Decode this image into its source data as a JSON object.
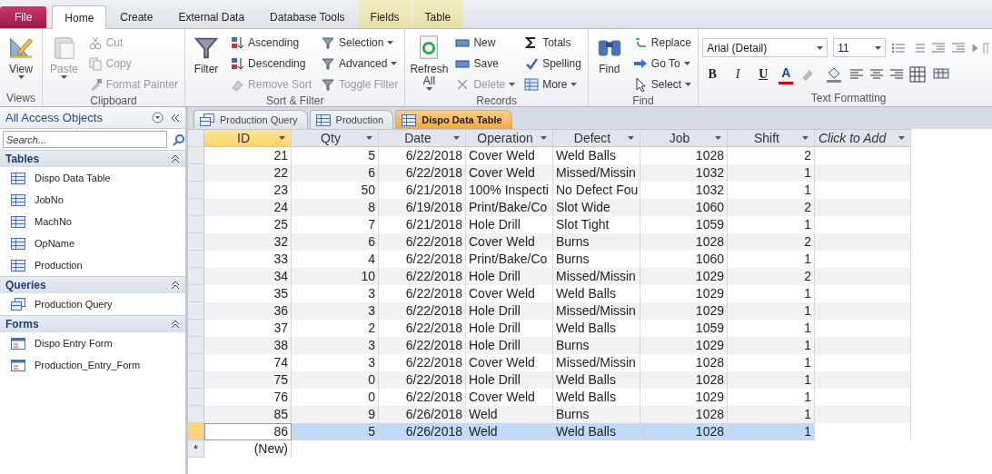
{
  "tabs": [
    {
      "label": "File",
      "kind": "file",
      "selected": false
    },
    {
      "label": "Home",
      "kind": "tab",
      "selected": true
    },
    {
      "label": "Create",
      "kind": "tab",
      "selected": false
    },
    {
      "label": "External Data",
      "kind": "tab",
      "selected": false
    },
    {
      "label": "Database Tools",
      "kind": "tab",
      "selected": false
    },
    {
      "label": "Fields",
      "kind": "context",
      "selected": false
    },
    {
      "label": "Table",
      "kind": "context",
      "selected": false
    }
  ],
  "ribbon": {
    "groups": [
      {
        "label": "Views",
        "kind": "buttons",
        "columns": [
          [
            {
              "label": "View",
              "kind": "large",
              "disabled": false,
              "dropdown": true
            }
          ]
        ]
      },
      {
        "label": "Clipboard",
        "kind": "buttons",
        "columns": [
          [
            {
              "label": "Paste",
              "kind": "large",
              "disabled": true,
              "dropdown": true
            }
          ],
          [
            {
              "label": "Cut",
              "kind": "small",
              "disabled": true,
              "dropdown": false
            },
            {
              "label": "Copy",
              "kind": "small",
              "disabled": true,
              "dropdown": false
            },
            {
              "label": "Format Painter",
              "kind": "small",
              "disabled": true,
              "dropdown": false
            }
          ]
        ]
      },
      {
        "label": "Sort & Filter",
        "kind": "buttons",
        "columns": [
          [
            {
              "label": "Filter",
              "kind": "large",
              "disabled": false,
              "dropdown": false
            }
          ],
          [
            {
              "label": "Ascending",
              "kind": "small",
              "disabled": false,
              "dropdown": false
            },
            {
              "label": "Descending",
              "kind": "small",
              "disabled": false,
              "dropdown": false
            },
            {
              "label": "Remove Sort",
              "kind": "small",
              "disabled": true,
              "dropdown": false
            }
          ],
          [
            {
              "label": "Selection",
              "kind": "small",
              "disabled": false,
              "dropdown": true
            },
            {
              "label": "Advanced",
              "kind": "small",
              "disabled": false,
              "dropdown": true
            },
            {
              "label": "Toggle Filter",
              "kind": "small",
              "disabled": true,
              "dropdown": false
            }
          ]
        ]
      },
      {
        "label": "Records",
        "kind": "buttons",
        "columns": [
          [
            {
              "label": "Refresh All",
              "kind": "large",
              "disabled": false,
              "dropdown": true
            }
          ],
          [
            {
              "label": "New",
              "kind": "small",
              "disabled": false,
              "dropdown": false
            },
            {
              "label": "Save",
              "kind": "small",
              "disabled": false,
              "dropdown": false
            },
            {
              "label": "Delete",
              "kind": "small",
              "disabled": true,
              "dropdown": true
            }
          ],
          [
            {
              "label": "Totals",
              "kind": "small",
              "disabled": false,
              "dropdown": false
            },
            {
              "label": "Spelling",
              "kind": "small",
              "disabled": false,
              "dropdown": false
            },
            {
              "label": "More",
              "kind": "small",
              "disabled": false,
              "dropdown": true
            }
          ]
        ]
      },
      {
        "label": "Find",
        "kind": "buttons",
        "columns": [
          [
            {
              "label": "Find",
              "kind": "large",
              "disabled": false,
              "dropdown": false
            }
          ],
          [
            {
              "label": "Replace",
              "kind": "small",
              "disabled": false,
              "dropdown": false
            },
            {
              "label": "Go To",
              "kind": "small",
              "disabled": false,
              "dropdown": true
            },
            {
              "label": "Select",
              "kind": "small",
              "disabled": false,
              "dropdown": true
            }
          ]
        ]
      },
      {
        "label": "Text Formatting",
        "kind": "formatting",
        "font": "Arial (Detail)",
        "size": "11",
        "styles": [
          "B",
          "I",
          "U"
        ],
        "color_letter": "A"
      }
    ]
  },
  "nav": {
    "title": "All Access Objects",
    "search": {
      "placeholder": "Search..."
    },
    "sections": [
      {
        "label": "Tables",
        "expanded": true,
        "items": [
          {
            "label": "Dispo Data Table",
            "kind": "table"
          },
          {
            "label": "JobNo",
            "kind": "table"
          },
          {
            "label": "MachNo",
            "kind": "table"
          },
          {
            "label": "OpName",
            "kind": "table"
          },
          {
            "label": "Production",
            "kind": "table"
          }
        ]
      },
      {
        "label": "Queries",
        "expanded": true,
        "items": [
          {
            "label": "Production Query",
            "kind": "query"
          }
        ]
      },
      {
        "label": "Forms",
        "expanded": true,
        "items": [
          {
            "label": "Dispo Entry Form",
            "kind": "form"
          },
          {
            "label": "Production_Entry_Form",
            "kind": "form"
          }
        ]
      }
    ]
  },
  "doc_tabs": [
    {
      "label": "Production Query",
      "kind": "query",
      "selected": false
    },
    {
      "label": "Production",
      "kind": "table",
      "selected": false
    },
    {
      "label": "Dispo Data Table",
      "kind": "table",
      "selected": true
    }
  ],
  "table": {
    "columns": [
      {
        "label": "ID",
        "selected": true
      },
      {
        "label": "Qty",
        "selected": false
      },
      {
        "label": "Date",
        "selected": false
      },
      {
        "label": "Operation",
        "selected": false
      },
      {
        "label": "Defect",
        "selected": false
      },
      {
        "label": "Job",
        "selected": false
      },
      {
        "label": "Shift",
        "selected": false
      }
    ],
    "add_column": "Click to Add",
    "rows": [
      {
        "cells": [
          "21",
          "5",
          "6/22/2018",
          "Cover Weld",
          "Weld Balls",
          "1028",
          "2"
        ],
        "selected": false
      },
      {
        "cells": [
          "22",
          "6",
          "6/22/2018",
          "Cover Weld",
          "Missed/Missin",
          "1032",
          "1"
        ],
        "selected": false
      },
      {
        "cells": [
          "23",
          "50",
          "6/21/2018",
          "100% Inspecti",
          "No Defect Fou",
          "1032",
          "1"
        ],
        "selected": false
      },
      {
        "cells": [
          "24",
          "8",
          "6/19/2018",
          "Print/Bake/Co",
          "Slot Wide",
          "1060",
          "2"
        ],
        "selected": false
      },
      {
        "cells": [
          "25",
          "7",
          "6/21/2018",
          "Hole Drill",
          "Slot Tight",
          "1059",
          "1"
        ],
        "selected": false
      },
      {
        "cells": [
          "32",
          "6",
          "6/22/2018",
          "Cover Weld",
          "Burns",
          "1028",
          "2"
        ],
        "selected": false
      },
      {
        "cells": [
          "33",
          "4",
          "6/22/2018",
          "Print/Bake/Co",
          "Burns",
          "1060",
          "1"
        ],
        "selected": false
      },
      {
        "cells": [
          "34",
          "10",
          "6/22/2018",
          "Hole Drill",
          "Missed/Missin",
          "1029",
          "2"
        ],
        "selected": false
      },
      {
        "cells": [
          "35",
          "3",
          "6/22/2018",
          "Cover Weld",
          "Weld Balls",
          "1029",
          "1"
        ],
        "selected": false
      },
      {
        "cells": [
          "36",
          "3",
          "6/22/2018",
          "Hole Drill",
          "Missed/Missin",
          "1029",
          "1"
        ],
        "selected": false
      },
      {
        "cells": [
          "37",
          "2",
          "6/22/2018",
          "Hole Drill",
          "Weld Balls",
          "1059",
          "1"
        ],
        "selected": false
      },
      {
        "cells": [
          "38",
          "3",
          "6/22/2018",
          "Hole Drill",
          "Burns",
          "1029",
          "1"
        ],
        "selected": false
      },
      {
        "cells": [
          "74",
          "3",
          "6/22/2018",
          "Cover Weld",
          "Missed/Missin",
          "1028",
          "1"
        ],
        "selected": false
      },
      {
        "cells": [
          "75",
          "0",
          "6/22/2018",
          "Hole Drill",
          "Weld Balls",
          "1028",
          "1"
        ],
        "selected": false
      },
      {
        "cells": [
          "76",
          "0",
          "6/22/2018",
          "Cover Weld",
          "Weld Balls",
          "1029",
          "1"
        ],
        "selected": false
      },
      {
        "cells": [
          "85",
          "9",
          "6/26/2018",
          "Weld",
          "Burns",
          "1028",
          "1"
        ],
        "selected": false
      },
      {
        "cells": [
          "86",
          "5",
          "6/26/2018",
          "Weld",
          "Weld Balls",
          "1028",
          "1"
        ],
        "selected": true
      }
    ],
    "new_row": {
      "marker": "*",
      "label": "(New)"
    }
  }
}
